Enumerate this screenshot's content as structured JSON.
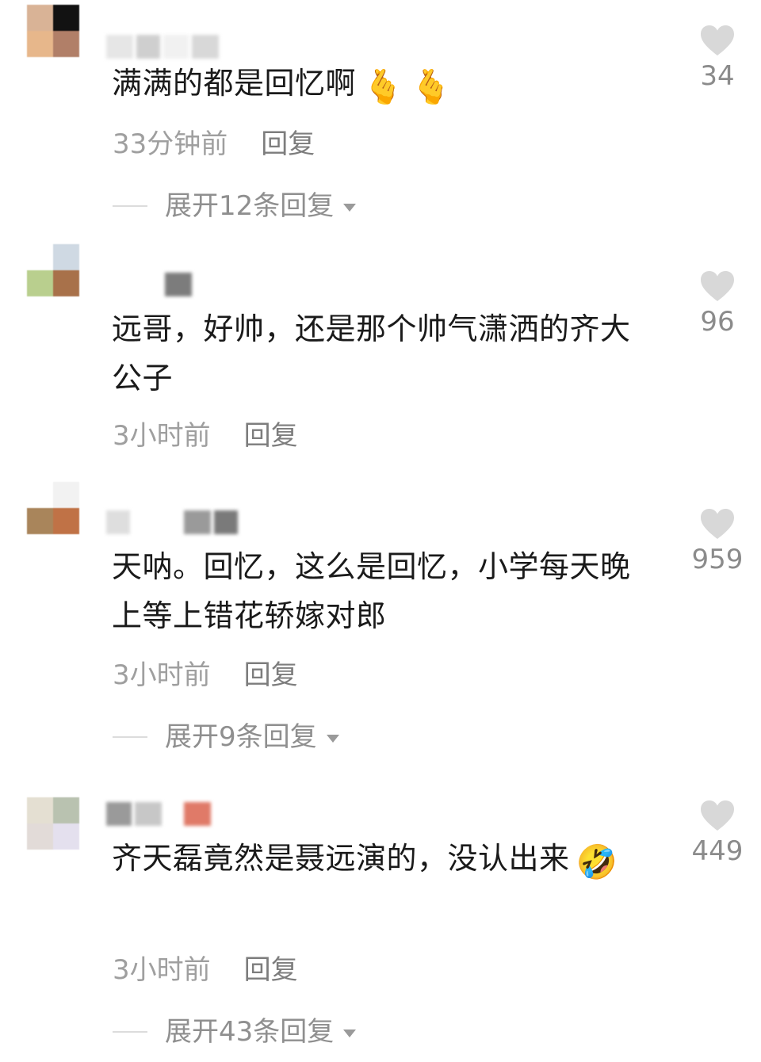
{
  "comments": [
    {
      "text": "满满的都是回忆啊",
      "emojis": [
        "🫰",
        "🫰"
      ],
      "time": "33分钟前",
      "reply_label": "回复",
      "likes": "34",
      "expand_label": "展开12条回复",
      "avatar_colors": [
        "#d9b396",
        "#121212",
        "#e7b78b",
        "#b17f68"
      ],
      "name_colors": [
        "#e6e6e6",
        "#cfcfcf",
        "#f1f1f1",
        "#d8d8d8"
      ]
    },
    {
      "text": "远哥，好帅，还是那个帅气潇洒的齐大公子",
      "emojis": [],
      "time": "3小时前",
      "reply_label": "回复",
      "likes": "96",
      "expand_label": "",
      "avatar_colors": [
        "#ffffff",
        "#cfd9e3",
        "#b9cf8e",
        "#a8714a"
      ],
      "name_colors": [
        "#ffffff",
        "#ffffff",
        "#7c7c7c",
        "#ffffff"
      ]
    },
    {
      "text": "天呐。回忆，这么是回忆，小学每天晚上等上错花轿嫁对郎",
      "emojis": [],
      "time": "3小时前",
      "reply_label": "回复",
      "likes": "959",
      "expand_label": "展开9条回复",
      "avatar_colors": [
        "#ffffff",
        "#f2f2f2",
        "#a9855b",
        "#c07246"
      ],
      "name_colors": [
        "#dedede",
        "#ffffff",
        "#9a9a9a",
        "#7a7a7a"
      ]
    },
    {
      "text": "齐天磊竟然是聂远演的，没认出来",
      "emojis": [
        "🤣"
      ],
      "time": "3小时前",
      "reply_label": "回复",
      "likes": "449",
      "expand_label": "展开43条回复",
      "avatar_colors": [
        "#e4dfd2",
        "#b9c2b0",
        "#e2dbd8",
        "#e4e0ee"
      ],
      "name_colors": [
        "#9a9a9a",
        "#c7c7c7",
        "#ffffff",
        "#e07a68"
      ]
    }
  ],
  "colors": {
    "text": "#1a1a1a",
    "meta": "#9f9f9f",
    "reply": "#7d7d7d",
    "heart": "#d8d8d8",
    "count": "#8b8b8b"
  },
  "icons": {
    "like": "heart-icon",
    "expand": "caret-down-icon"
  }
}
